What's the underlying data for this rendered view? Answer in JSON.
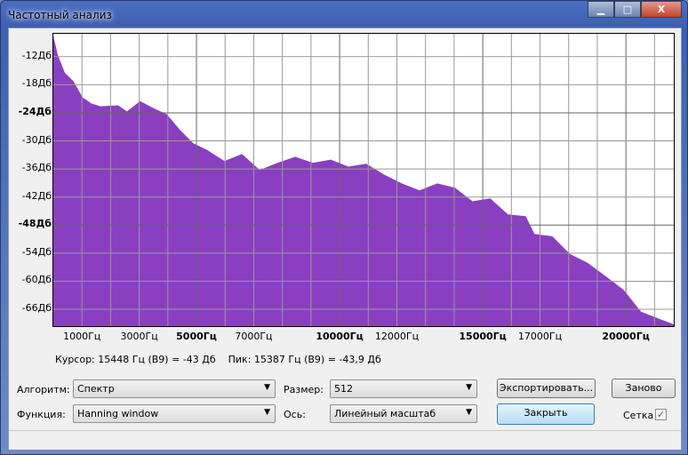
{
  "window": {
    "title": "Частотный анализ",
    "minimize": "▁",
    "maximize": "□",
    "close": "X"
  },
  "info": {
    "cursor": "Курсор: 15448 Гц (B9) = -43 Дб",
    "peak": "Пик: 15387 Гц (B9) = -43,9 Дб"
  },
  "controls": {
    "algorithm_label": "Алгоритм:",
    "algorithm_value": "Спектр",
    "size_label": "Размер:",
    "size_value": "512",
    "function_label": "Функция:",
    "function_value": "Hanning window",
    "axis_label": "Ось:",
    "axis_value": "Линейный масштаб",
    "export_label": "Экспортировать...",
    "redo_label": "Заново",
    "close_label": "Закрыть",
    "grid_label": "Сетка",
    "grid_checked": true,
    "check_mark": "✓",
    "arrow": "▼"
  },
  "chart_data": {
    "type": "area",
    "xlim": [
      0,
      21672
    ],
    "ylim": [
      -69.6,
      -7.1
    ],
    "grid": true,
    "fill_color": "#8a3fc0",
    "xticks": [
      {
        "v": 1000,
        "label": "1000Гц",
        "bold": false
      },
      {
        "v": 3000,
        "label": "3000Гц",
        "bold": false
      },
      {
        "v": 5000,
        "label": "5000Гц",
        "bold": true
      },
      {
        "v": 7000,
        "label": "7000Гц",
        "bold": false
      },
      {
        "v": 10000,
        "label": "10000Гц",
        "bold": true
      },
      {
        "v": 12000,
        "label": "12000Гц",
        "bold": false
      },
      {
        "v": 15000,
        "label": "15000Гц",
        "bold": true
      },
      {
        "v": 17000,
        "label": "17000Гц",
        "bold": false
      },
      {
        "v": 20000,
        "label": "20000Гц",
        "bold": true
      }
    ],
    "yticks": [
      {
        "v": -12,
        "label": "-12Дб",
        "bold": false
      },
      {
        "v": -18,
        "label": "-18Дб",
        "bold": false
      },
      {
        "v": -24,
        "label": "-24Дб",
        "bold": true
      },
      {
        "v": -30,
        "label": "-30Дб",
        "bold": false
      },
      {
        "v": -36,
        "label": "-36Дб",
        "bold": false
      },
      {
        "v": -42,
        "label": "-42Дб",
        "bold": false
      },
      {
        "v": -48,
        "label": "-48Дб",
        "bold": true
      },
      {
        "v": -54,
        "label": "-54Дб",
        "bold": false
      },
      {
        "v": -60,
        "label": "-60Дб",
        "bold": false
      },
      {
        "v": -66,
        "label": "-66Дб",
        "bold": false
      }
    ],
    "x": [
      0,
      155,
      400,
      710,
      1020,
      1330,
      1640,
      2260,
      2570,
      3030,
      3500,
      3960,
      4430,
      4890,
      5360,
      5980,
      6590,
      7210,
      7830,
      8450,
      9070,
      9690,
      10310,
      10930,
      11550,
      12170,
      12790,
      13410,
      14030,
      14640,
      15260,
      15880,
      16500,
      16810,
      17430,
      18050,
      18670,
      19290,
      19910,
      20530,
      21150,
      21672
    ],
    "y": [
      -7.5,
      -11.6,
      -15.4,
      -17.3,
      -20.7,
      -22.0,
      -22.6,
      -22.4,
      -23.7,
      -21.5,
      -23.0,
      -24.3,
      -27.7,
      -30.5,
      -31.9,
      -34.3,
      -32.8,
      -36.2,
      -34.7,
      -33.4,
      -34.7,
      -34.0,
      -35.5,
      -34.9,
      -37.2,
      -39.1,
      -40.6,
      -39.1,
      -40.0,
      -42.9,
      -42.3,
      -45.7,
      -46.1,
      -49.9,
      -50.4,
      -54.2,
      -56.1,
      -58.9,
      -61.8,
      -66.5,
      -68.0,
      -69.2
    ]
  }
}
